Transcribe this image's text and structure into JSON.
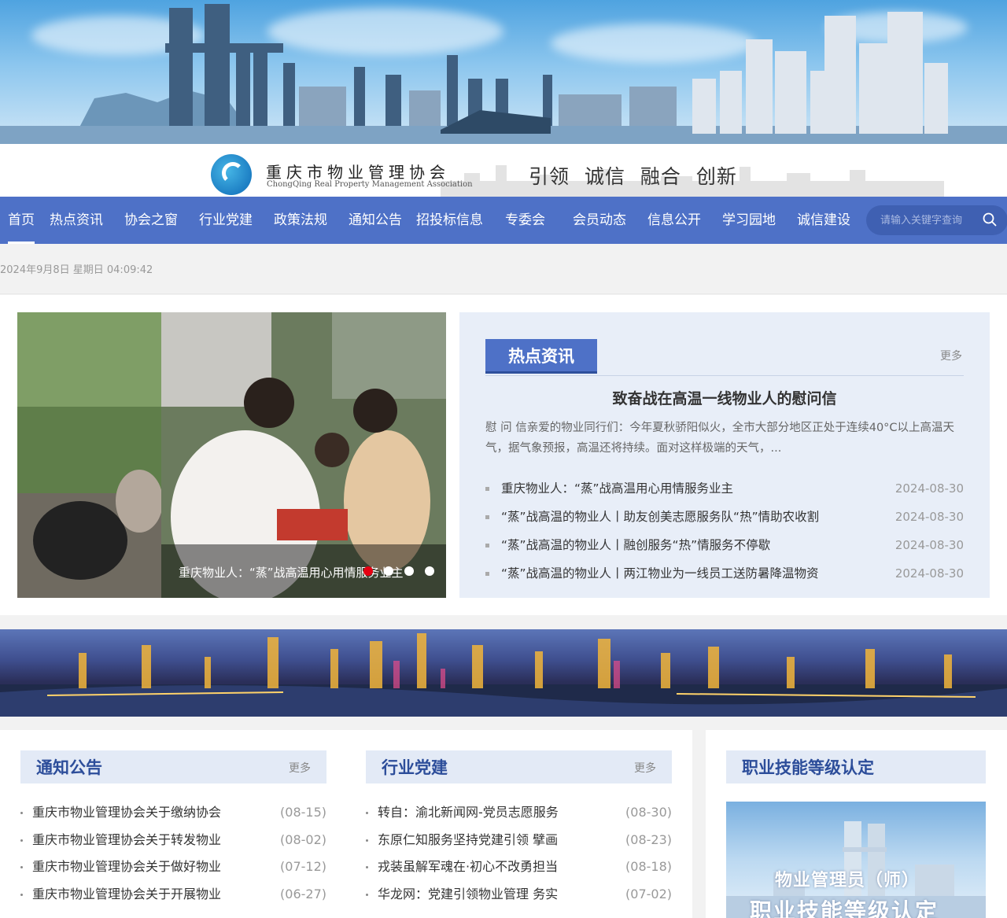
{
  "org": {
    "name_cn": "重庆市物业管理协会",
    "name_en": "ChongQing Real Property Management Association",
    "slogan": "引领  诚信  融合  创新"
  },
  "nav": {
    "items": [
      "首页",
      "热点资讯",
      "协会之窗",
      "行业党建",
      "政策法规",
      "通知公告",
      "招投标信息",
      "专委会",
      "会员动态",
      "信息公开",
      "学习园地",
      "诚信建设"
    ],
    "search_placeholder": "请输入关键字查询"
  },
  "datetime": "2024年9月8日 星期日 04:09:42",
  "slider": {
    "caption": "重庆物业人：“蒸”战高温用心用情服务业主",
    "dot_count": 4,
    "active_dot": 0
  },
  "hot": {
    "tab": "热点资讯",
    "more": "更多",
    "headline": "致奋战在高温一线物业人的慰问信",
    "summary": "慰 问 信亲爱的物业同行们：今年夏秋骄阳似火，全市大部分地区正处于连续40°C以上高温天气，据气象预报，高温还将持续。面对这样极端的天气，...",
    "items": [
      {
        "title": "重庆物业人：“蒸”战高温用心用情服务业主",
        "date": "2024-08-30"
      },
      {
        "title": "“蒸”战高温的物业人丨助友创美志愿服务队“热”情助农收割",
        "date": "2024-08-30"
      },
      {
        "title": "“蒸”战高温的物业人丨融创服务“热”情服务不停歇",
        "date": "2024-08-30"
      },
      {
        "title": "“蒸”战高温的物业人丨两江物业为一线员工送防暑降温物资",
        "date": "2024-08-30"
      }
    ]
  },
  "notice": {
    "title": "通知公告",
    "more": "更多",
    "items": [
      {
        "title": "重庆市物业管理协会关于缴纳协会",
        "date": "(08-15)"
      },
      {
        "title": "重庆市物业管理协会关于转发物业",
        "date": "(08-02)"
      },
      {
        "title": "重庆市物业管理协会关于做好物业",
        "date": "(07-12)"
      },
      {
        "title": "重庆市物业管理协会关于开展物业",
        "date": "(06-27)"
      }
    ]
  },
  "party": {
    "title": "行业党建",
    "more": "更多",
    "items": [
      {
        "title": "转自：渝北新闻网-党员志愿服务",
        "date": "(08-30)"
      },
      {
        "title": "东原仁知服务坚持党建引领 擘画",
        "date": "(08-23)"
      },
      {
        "title": "戎装虽解军魂在·初心不改勇担当",
        "date": "(08-18)"
      },
      {
        "title": "华龙网：党建引领物业管理 务实",
        "date": "(07-02)"
      }
    ]
  },
  "cert": {
    "title": "职业技能等级认定",
    "image_text_1": "物业管理员（师）",
    "image_text_2": "职业技能等级认定"
  },
  "colors": {
    "nav_bg": "#4e71c7",
    "accent_red": "#e60012",
    "section_title": "#2c4d9a",
    "panel_bg": "#e8eef8"
  }
}
